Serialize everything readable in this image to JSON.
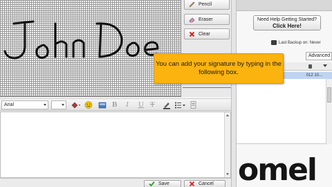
{
  "signature_canvas": {
    "drawn_text": "John Doe"
  },
  "tools": {
    "pencil_label": "Pencil",
    "eraser_label": "Eraser",
    "clear_label": "Clear"
  },
  "preview": {
    "text": "John Doe"
  },
  "editor_toolbar": {
    "font_name": "Arial",
    "bold_label": "B",
    "italic_label": "I",
    "underline_label": "U",
    "strike_label": "T"
  },
  "tooltip": {
    "text": "You can add your signature by typing in the following box."
  },
  "footer": {
    "save_label": "Save",
    "cancel_label": "Cancel"
  },
  "right_panel": {
    "help_line1": "Need Help Getting Started?",
    "help_line2": "Click Here!",
    "backup_text": "Last Backup on: Never",
    "tab_advanced": "Advanced",
    "row_partial": "012 10..."
  },
  "logo": {
    "text": "omel"
  },
  "colors": {
    "tooltip_bg": "#fbb30f",
    "selection_row": "#bfd3f2",
    "clear_icon": "#d42020"
  }
}
